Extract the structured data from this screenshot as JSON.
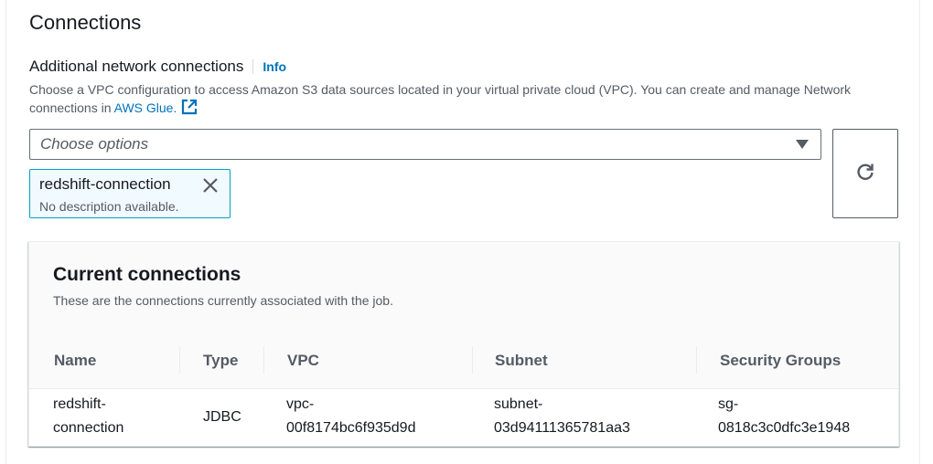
{
  "section": {
    "title": "Connections"
  },
  "field": {
    "label": "Additional network connections",
    "info": "Info",
    "description_text": "Choose a VPC configuration to access Amazon S3 data sources located in your virtual private cloud (VPC). You can create and manage Network connections in ",
    "description_link": "AWS Glue.",
    "select_placeholder": "Choose options"
  },
  "token": {
    "name": "redshift-connection",
    "description": "No description available."
  },
  "panel": {
    "title": "Current connections",
    "description": "These are the connections currently associated with the job.",
    "columns": [
      "Name",
      "Type",
      "VPC",
      "Subnet",
      "Security Groups"
    ],
    "rows": [
      {
        "name_line1": "redshift-",
        "name_line2": "connection",
        "type": "JDBC",
        "vpc_line1": "vpc-",
        "vpc_line2": "00f8174bc6f935d9d",
        "subnet_line1": "subnet-",
        "subnet_line2": "03d94111365781aa3",
        "sg_line1": "sg-",
        "sg_line2": "0818c3c0dfc3e1948"
      }
    ]
  },
  "colors": {
    "link": "#0073bb",
    "token_bg": "#f1faff",
    "token_border": "#00a1c9",
    "text": "#16191f",
    "secondary_text": "#545b64"
  },
  "icons": {
    "external": "external-link-icon",
    "caret": "caret-down-icon",
    "refresh": "refresh-icon",
    "remove": "close-icon"
  }
}
